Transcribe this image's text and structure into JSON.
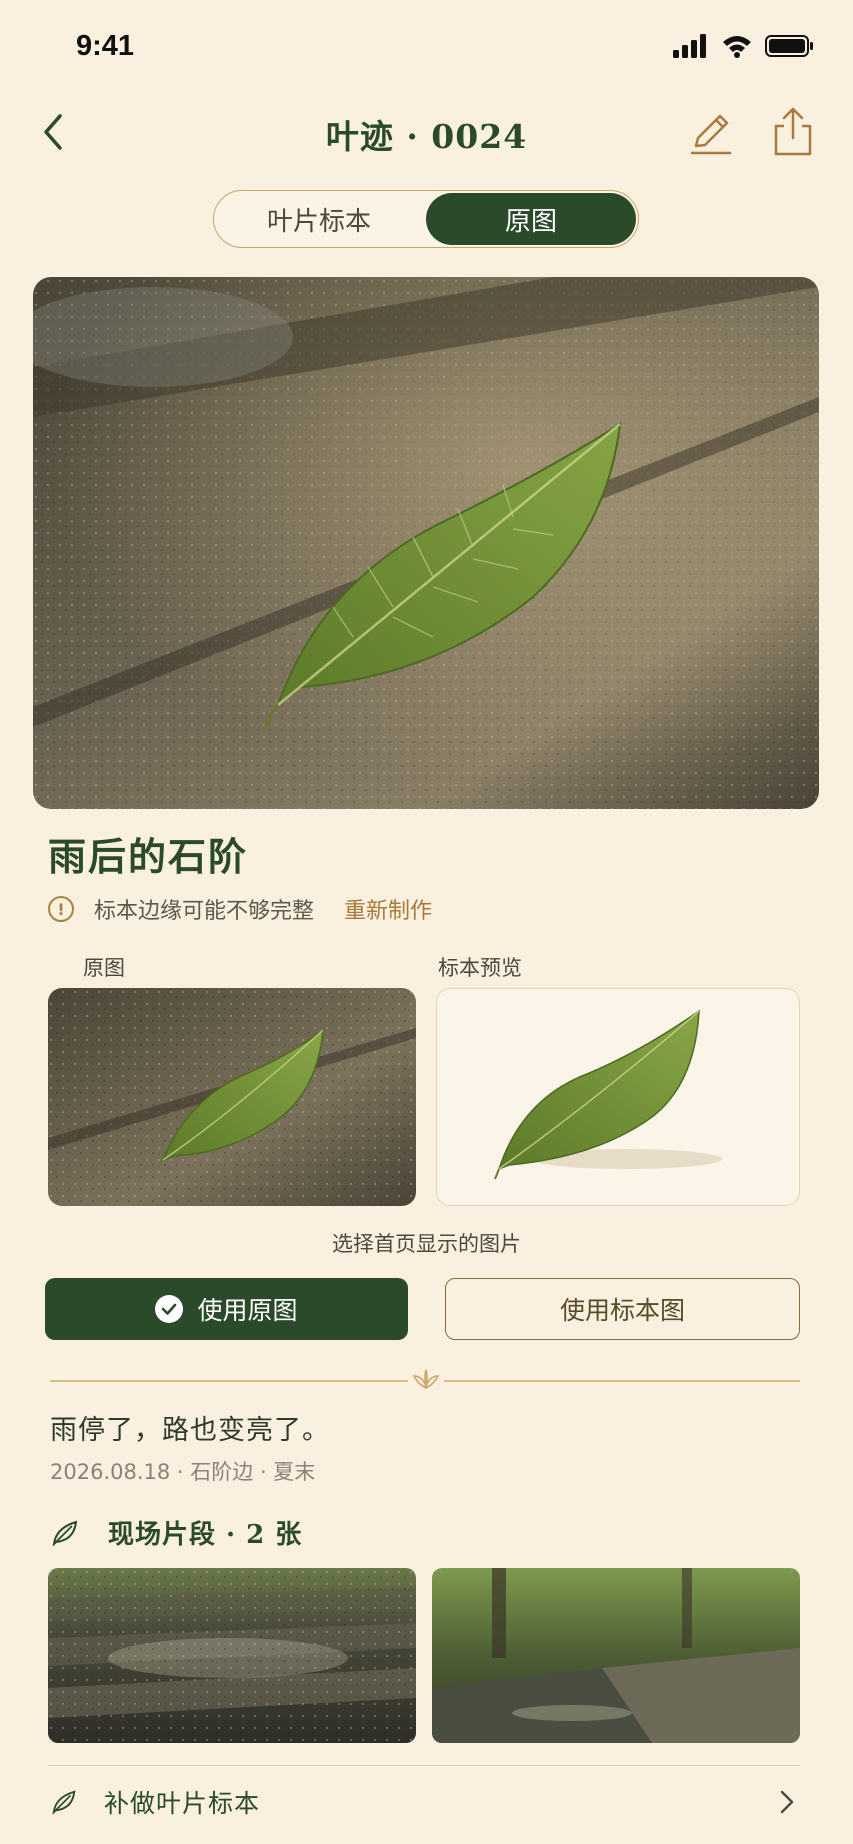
{
  "status": {
    "time": "9:41"
  },
  "nav": {
    "title": "叶迹 · 0024"
  },
  "segmented": {
    "items": [
      "叶片标本",
      "原图"
    ],
    "active": "原图"
  },
  "record": {
    "title": "雨后的石阶",
    "warning": "标本边缘可能不够完整",
    "redo": "重新制作"
  },
  "compare": {
    "original_label": "原图",
    "specimen_label": "标本预览",
    "choose_label": "选择首页显示的图片",
    "use_original": "使用原图",
    "use_specimen": "使用标本图"
  },
  "note": {
    "text": "雨停了，路也变亮了。",
    "meta": "2026.08.18 · 石阶边 · 夏末"
  },
  "clips": {
    "title": "现场片段 · 2 张",
    "count": 2
  },
  "footer": {
    "make_specimen": "补做叶片标本"
  },
  "colors": {
    "background": "#f9f0e0",
    "accent": "#2a4a2a",
    "gold": "#a87b3a"
  }
}
